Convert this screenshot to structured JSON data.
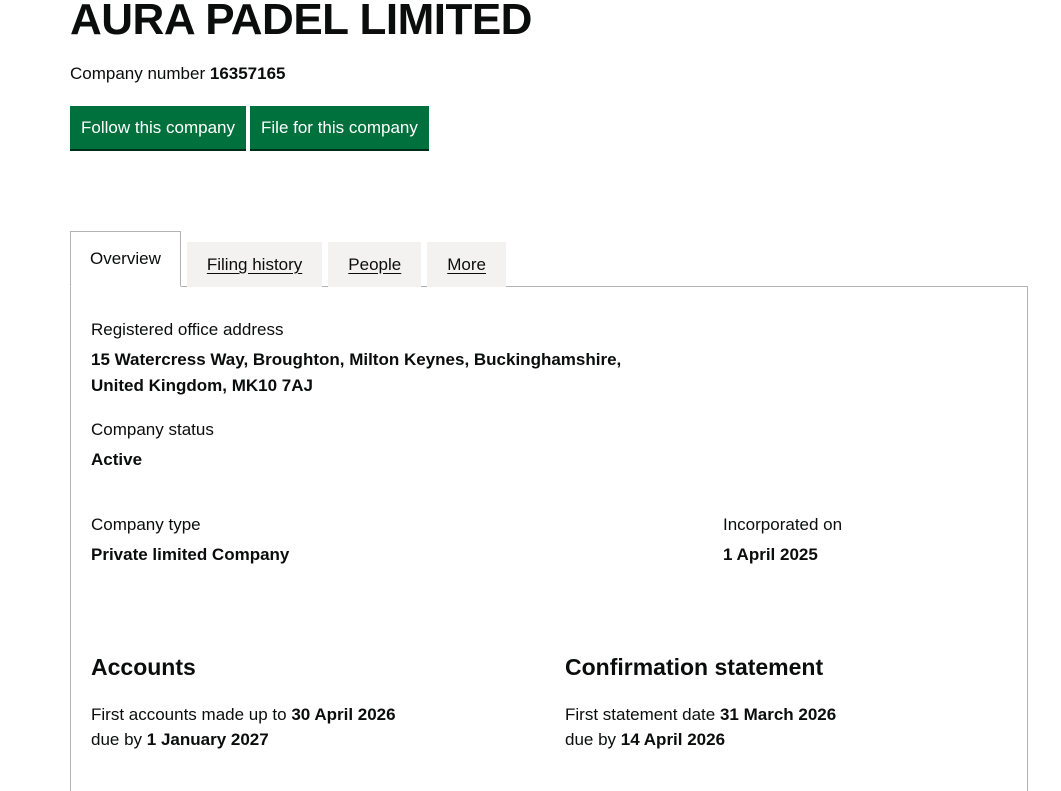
{
  "company": {
    "name": "AURA PADEL LIMITED",
    "number_label": "Company number",
    "number": "16357165"
  },
  "actions": {
    "follow": "Follow this company",
    "file": "File for this company"
  },
  "tabs": [
    {
      "label": "Overview"
    },
    {
      "label": "Filing history"
    },
    {
      "label": "People"
    },
    {
      "label": "More"
    }
  ],
  "overview": {
    "registered_office": {
      "label": "Registered office address",
      "line1": "15 Watercress Way, Broughton, Milton Keynes, Buckinghamshire,",
      "line2": "United Kingdom, MK10 7AJ"
    },
    "status": {
      "label": "Company status",
      "value": "Active"
    },
    "type": {
      "label": "Company type",
      "value": "Private limited Company"
    },
    "incorporated": {
      "label": "Incorporated on",
      "value": "1 April 2025"
    },
    "accounts": {
      "heading": "Accounts",
      "made_up_prefix": "First accounts made up to",
      "made_up_date": "30 April 2026",
      "due_prefix": "due by",
      "due_date": "1 January 2027"
    },
    "confirmation": {
      "heading": "Confirmation statement",
      "date_prefix": "First statement date",
      "date": "31 March 2026",
      "due_prefix": "due by",
      "due_date": "14 April 2026"
    }
  },
  "colors": {
    "button": "#00703c",
    "tab_bg": "#f3f2f1",
    "border": "#b1b4b6",
    "text": "#0b0c0c"
  }
}
